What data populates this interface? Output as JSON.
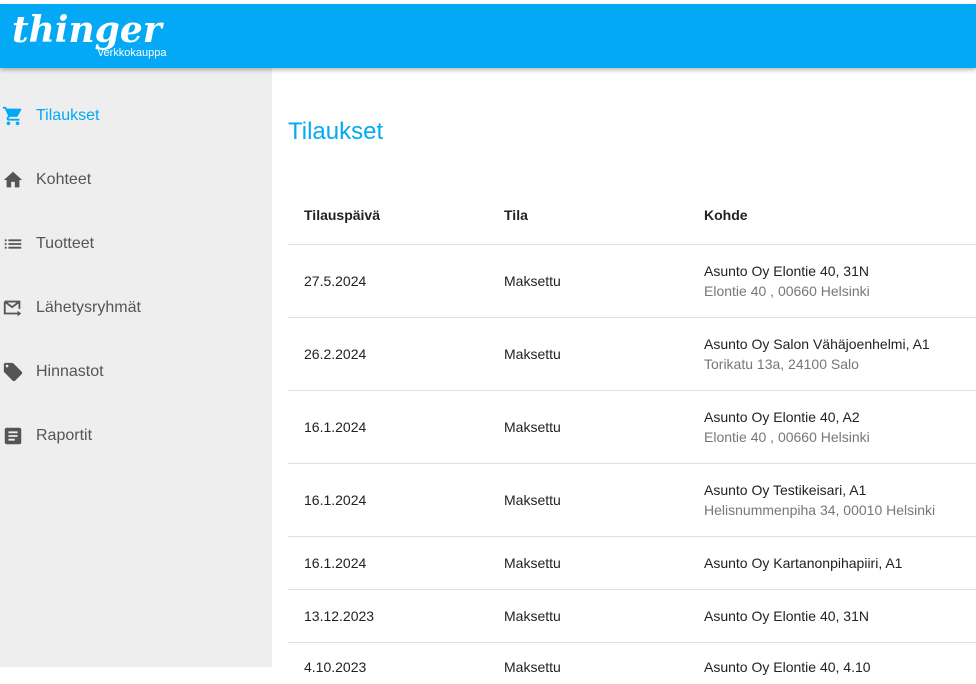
{
  "app": {
    "logo": "thinger",
    "logo_subtitle": "verkkokauppa",
    "brand_color": "#03a9f4"
  },
  "sidebar": {
    "items": [
      {
        "label": "Tilaukset",
        "icon": "cart-icon",
        "active": true
      },
      {
        "label": "Kohteet",
        "icon": "home-icon",
        "active": false
      },
      {
        "label": "Tuotteet",
        "icon": "list-icon",
        "active": false
      },
      {
        "label": "Lähetysryhmät",
        "icon": "mail-forward-icon",
        "active": false
      },
      {
        "label": "Hinnastot",
        "icon": "tag-icon",
        "active": false
      },
      {
        "label": "Raportit",
        "icon": "report-icon",
        "active": false
      }
    ]
  },
  "main": {
    "title": "Tilaukset",
    "table": {
      "headers": [
        "Tilauspäivä",
        "Tila",
        "Kohde"
      ],
      "rows": [
        {
          "date": "27.5.2024",
          "status": "Maksettu",
          "target": "Asunto Oy Elontie 40, 31N",
          "address": "Elontie 40 , 00660 Helsinki"
        },
        {
          "date": "26.2.2024",
          "status": "Maksettu",
          "target": "Asunto Oy Salon Vähäjoenhelmi, A1",
          "address": "Torikatu 13a, 24100 Salo"
        },
        {
          "date": "16.1.2024",
          "status": "Maksettu",
          "target": "Asunto Oy Elontie 40, A2",
          "address": "Elontie 40 , 00660 Helsinki"
        },
        {
          "date": "16.1.2024",
          "status": "Maksettu",
          "target": "Asunto Oy Testikeisari, A1",
          "address": "Helisnummenpiha 34, 00010 Helsinki"
        },
        {
          "date": "16.1.2024",
          "status": "Maksettu",
          "target": "Asunto Oy Kartanonpihapiiri, A1",
          "address": ""
        },
        {
          "date": "13.12.2023",
          "status": "Maksettu",
          "target": "Asunto Oy Elontie 40, 31N",
          "address": ""
        },
        {
          "date": "4.10.2023",
          "status": "Maksettu",
          "target": "Asunto Oy Elontie 40, 4.10",
          "address": ""
        }
      ]
    }
  }
}
